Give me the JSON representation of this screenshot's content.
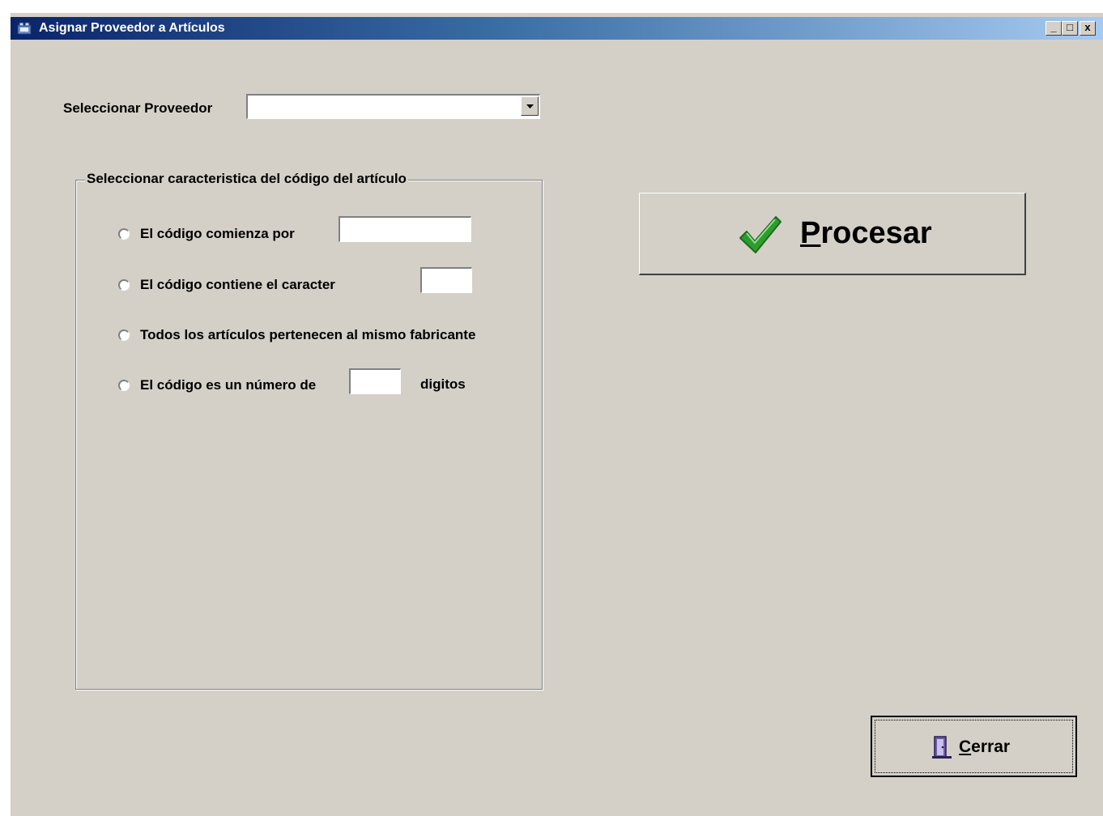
{
  "window": {
    "title": "Asignar Proveedor a Artículos",
    "controls": {
      "minimize": "_",
      "maximize": "□",
      "close": "x"
    }
  },
  "supplier": {
    "label": "Seleccionar Proveedor",
    "selected": ""
  },
  "group": {
    "legend": "Seleccionar caracteristica del código del artículo",
    "options": [
      {
        "label": "El código comienza por",
        "value": ""
      },
      {
        "label": "El código contiene el caracter",
        "value": ""
      },
      {
        "label": "Todos los artículos pertenecen al mismo fabricante"
      },
      {
        "label": "El código es un número de",
        "value": "",
        "suffix": "digitos"
      }
    ]
  },
  "actions": {
    "process_label": "Procesar",
    "close_label": "Cerrar"
  },
  "icons": {
    "title": "app-icon",
    "process": "checkmark-icon",
    "close": "door-exit-icon"
  },
  "colors": {
    "face": "#d4d0c8",
    "title_start": "#0a246a",
    "title_end": "#a6caf0",
    "check": "#2e9c2e"
  }
}
